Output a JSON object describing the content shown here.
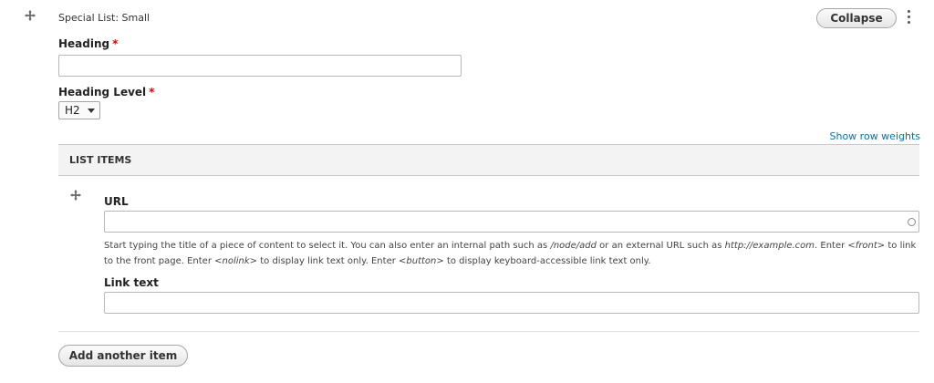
{
  "paragraph": {
    "type_label": "Special List: Small",
    "collapse_label": "Collapse"
  },
  "heading": {
    "label": "Heading",
    "required_mark": "*",
    "value": ""
  },
  "heading_level": {
    "label": "Heading Level",
    "required_mark": "*",
    "selected": "H2"
  },
  "show_row_weights": "Show row weights",
  "list_items": {
    "header": "LIST ITEMS",
    "url": {
      "label": "URL",
      "value": "",
      "description": {
        "t1": "Start typing the title of a piece of content to select it. You can also enter an internal path such as ",
        "e1": "/node/add",
        "t2": " or an external URL such as ",
        "e2": "http://example.com",
        "t3": ". Enter ",
        "e3": "<front>",
        "t4": " to link to the front page. Enter ",
        "e4": "<nolink>",
        "t5": " to display link text only. Enter ",
        "e5": "<button>",
        "t6": " to display keyboard-accessible link text only."
      }
    },
    "link_text": {
      "label": "Link text",
      "value": ""
    }
  },
  "add_another_label": "Add another item",
  "icons": {
    "drag": "drag-handle-icon",
    "kebab": "kebab-menu-icon",
    "autocomplete": "autocomplete-circle-icon",
    "dropdown": "chevron-down-icon"
  }
}
